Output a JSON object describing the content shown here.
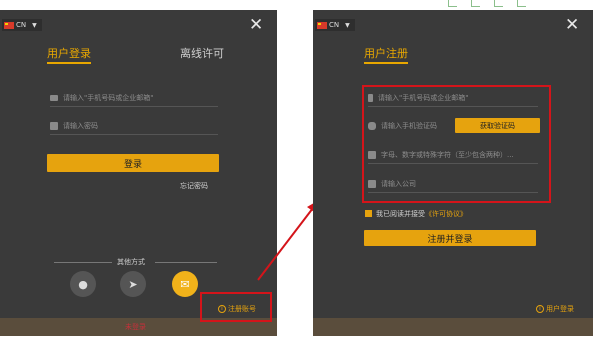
{
  "left": {
    "language": "CN",
    "tab_login": "用户登录",
    "tab_offline": "离线许可",
    "account_placeholder": "请输入\"手机号码或企业邮箱\"",
    "password_placeholder": "请输入密码",
    "login_button": "登录",
    "forgot_password": "忘记密码",
    "other_methods": "其他方式",
    "register_link": "注册账号",
    "bottom_text": "未登录"
  },
  "right": {
    "language": "CN",
    "title": "用户注册",
    "account_placeholder": "请输入\"手机号码或企业邮箱\"",
    "code_placeholder": "请输入手机验证码",
    "get_code_button": "获取验证码",
    "password_placeholder": "字母、数字或特殊字符（至少包含两种）...",
    "company_placeholder": "请输入公司",
    "agree_text": "我已阅读并接受",
    "agreement_link": "《许可协议》",
    "register_button": "注册并登录",
    "login_link": "用户登录"
  },
  "colors": {
    "accent": "#e6a30e",
    "highlight_box": "#d4141a",
    "panel": "#3a3a3a"
  },
  "icons": [
    "flag-cn-icon",
    "close-icon",
    "mail-icon",
    "lock-icon",
    "phone-icon",
    "shield-icon",
    "building-icon",
    "wechat-icon",
    "send-icon",
    "envelope-icon",
    "info-icon"
  ]
}
